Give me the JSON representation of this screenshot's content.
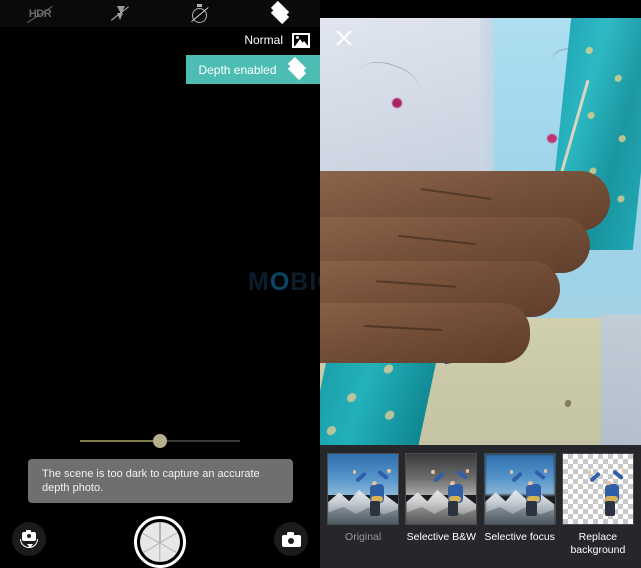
{
  "left_pane": {
    "top_icons": [
      {
        "name": "hdr-off-icon",
        "label": "HDR"
      },
      {
        "name": "flash-off-icon",
        "label": "Flash off"
      },
      {
        "name": "timer-off-icon",
        "label": "Timer off"
      },
      {
        "name": "depth-layers-icon",
        "label": "Depth"
      }
    ],
    "mode": {
      "label": "Normal",
      "icon": "landscape-icon"
    },
    "depth_banner": {
      "label": "Depth enabled",
      "icon": "layers-icon",
      "color": "#4dbdb4"
    },
    "watermark": "MOBIGYAAN",
    "zoom_slider": {
      "value": 50,
      "min": 0,
      "max": 100,
      "track_active_color": "#7e7b4a"
    },
    "toast": {
      "message": "The scene is too dark to capture an accurate depth photo."
    },
    "bottom_controls": {
      "switch_camera": "switch-camera-icon",
      "shutter": "shutter-button",
      "gallery": "gallery-camera-icon"
    }
  },
  "right_pane": {
    "close_label": "×",
    "filters": [
      {
        "label": "Original",
        "selected": true,
        "style": "color"
      },
      {
        "label": "Selective B&W",
        "selected": false,
        "style": "gray"
      },
      {
        "label": "Selective focus",
        "selected": false,
        "style": "focus"
      },
      {
        "label": "Replace background",
        "selected": false,
        "style": "transparent"
      }
    ]
  }
}
